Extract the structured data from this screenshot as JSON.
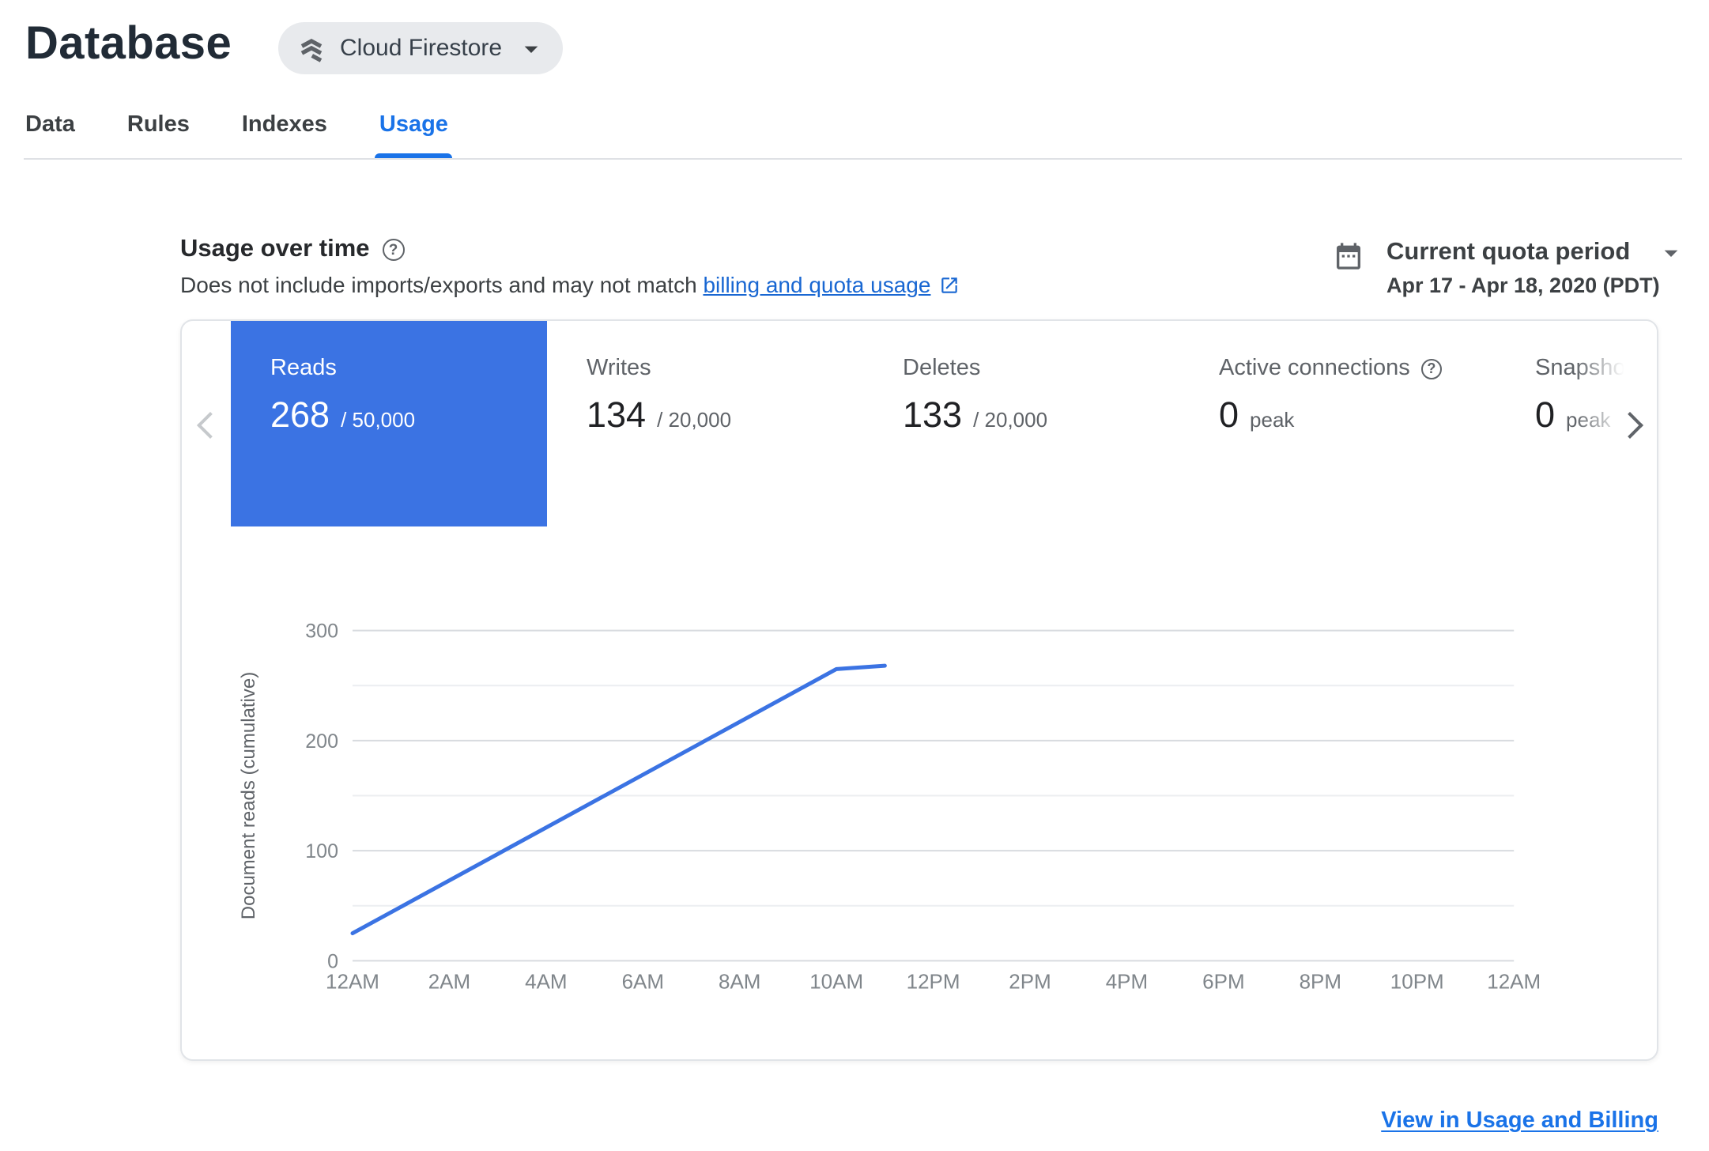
{
  "colors": {
    "accent": "#3b73e3",
    "tab_active": "#1a73e8",
    "link": "#1967d2"
  },
  "icons": {
    "help": "?"
  },
  "header": {
    "title": "Database",
    "product_selector": {
      "label": "Cloud Firestore"
    }
  },
  "tabs": [
    {
      "label": "Data",
      "active": false
    },
    {
      "label": "Rules",
      "active": false
    },
    {
      "label": "Indexes",
      "active": false
    },
    {
      "label": "Usage",
      "active": true
    }
  ],
  "usage": {
    "heading": "Usage over time",
    "description_prefix": "Does not include imports/exports and may not match ",
    "description_link_text": "billing and quota usage",
    "quota": {
      "label": "Current quota period",
      "range": "Apr 17 - Apr 18, 2020 (PDT)"
    }
  },
  "metrics": [
    {
      "name": "Reads",
      "value": "268",
      "limit": "/ 50,000",
      "selected": true
    },
    {
      "name": "Writes",
      "value": "134",
      "limit": "/ 20,000",
      "selected": false
    },
    {
      "name": "Deletes",
      "value": "133",
      "limit": "/ 20,000",
      "selected": false
    },
    {
      "name": "Active connections",
      "value": "0",
      "limit": "peak",
      "selected": false,
      "has_help": true
    },
    {
      "name": "Snapshot listeners",
      "value": "0",
      "limit": "peak",
      "selected": false
    }
  ],
  "footer": {
    "link": "View in Usage and Billing"
  },
  "chart_data": {
    "type": "line",
    "title": "",
    "ylabel": "Document reads (cumulative)",
    "xlabel": "",
    "x_labels": [
      "12AM",
      "2AM",
      "4AM",
      "6AM",
      "8AM",
      "10AM",
      "12PM",
      "2PM",
      "4PM",
      "6PM",
      "8PM",
      "10PM",
      "12AM"
    ],
    "xlim_hours": [
      0,
      24
    ],
    "ylim": [
      0,
      300
    ],
    "y_ticks": [
      0,
      100,
      200,
      300
    ],
    "y_gridlines": [
      0,
      50,
      100,
      150,
      200,
      250,
      300
    ],
    "grid": "horizontal",
    "legend": "none",
    "series": [
      {
        "name": "Document reads (cumulative)",
        "color": "#3b73e3",
        "points": [
          {
            "x": 0,
            "y": 25
          },
          {
            "x": 10,
            "y": 265
          },
          {
            "x": 11,
            "y": 268
          }
        ]
      }
    ]
  }
}
